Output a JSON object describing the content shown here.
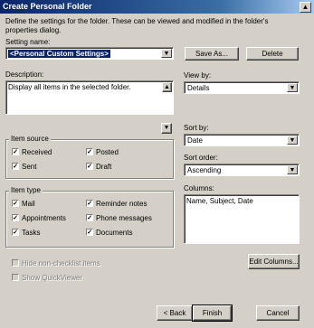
{
  "window": {
    "title": "Create Personal Folder",
    "help_glyph": "?"
  },
  "intro_text": "Define the settings for the folder.  These can be viewed and modified in the folder's properties dialog.",
  "setting_name": {
    "label": "Setting name:",
    "value": "<Personal Custom Settings>"
  },
  "buttons": {
    "save_as": "Save As...",
    "delete": "Delete",
    "edit_columns": "Edit Columns...",
    "back": "< Back",
    "finish": "Finish",
    "cancel": "Cancel"
  },
  "description": {
    "label": "Description:",
    "value": "Display all items in the selected folder."
  },
  "view_by": {
    "label": "View by:",
    "value": "Details"
  },
  "sort_by": {
    "label": "Sort by:",
    "value": "Date"
  },
  "sort_order": {
    "label": "Sort order:",
    "value": "Ascending"
  },
  "columns": {
    "label": "Columns:",
    "value": "Name, Subject, Date"
  },
  "item_source": {
    "title": "Item source",
    "items": [
      {
        "label": "Received",
        "checked": true
      },
      {
        "label": "Posted",
        "checked": true
      },
      {
        "label": "Sent",
        "checked": true
      },
      {
        "label": "Draft",
        "checked": true
      }
    ]
  },
  "item_type": {
    "title": "Item type",
    "items": [
      {
        "label": "Mail",
        "checked": true
      },
      {
        "label": "Reminder notes",
        "checked": true
      },
      {
        "label": "Appointments",
        "checked": true
      },
      {
        "label": "Phone messages",
        "checked": true
      },
      {
        "label": "Tasks",
        "checked": true
      },
      {
        "label": "Documents",
        "checked": true
      }
    ]
  },
  "options": {
    "hide_non_checklist": "Hide non-checklist items",
    "show_quickviewer": "Show QuickViewer"
  },
  "glyphs": {
    "check": "✓",
    "dropdown": "▼",
    "scroll_up": "▲",
    "scroll_down": "▼"
  }
}
